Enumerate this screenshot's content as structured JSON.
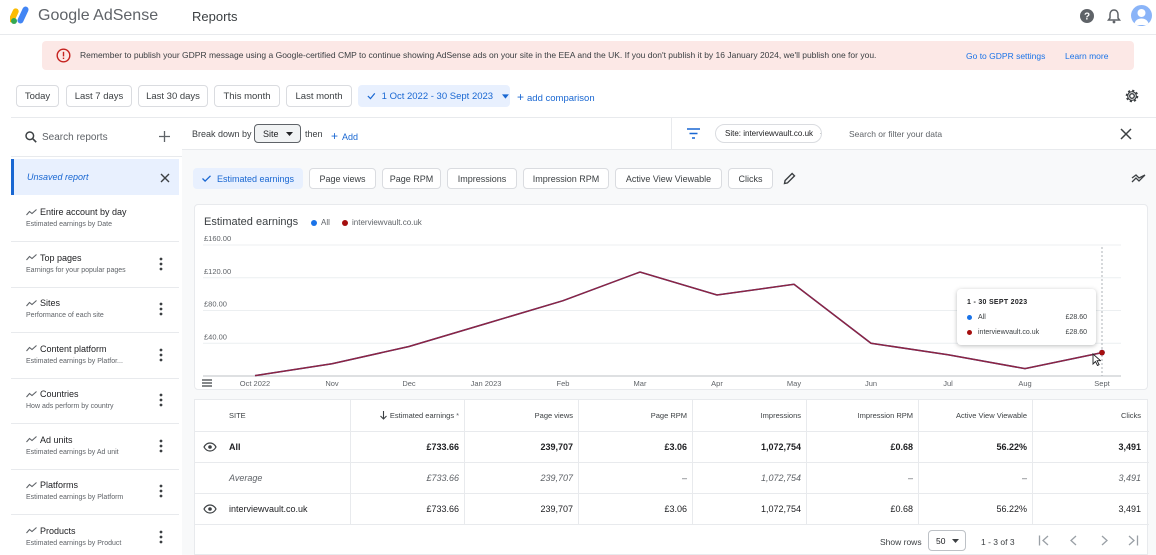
{
  "app": {
    "name": "Google AdSense",
    "page_title": "Reports"
  },
  "colors": {
    "accent": "#1967d2",
    "series_all": "#1a73e8",
    "series_site": "#a50e0e",
    "line": "#8e2440",
    "banner_bg": "#fce8e6"
  },
  "banner": {
    "message": "Remember to publish your GDPR message using a Google-certified CMP to continue showing AdSense ads on your site in the EEA and the UK. If you don't publish it by 16 January 2024, we'll publish one for you.",
    "link_gdpr": "Go to GDPR settings",
    "link_learn": "Learn more"
  },
  "date_chips": [
    "Today",
    "Last 7 days",
    "Last 30 days",
    "This month",
    "Last month"
  ],
  "date_range": "1 Oct 2022 - 30 Sept 2023",
  "add_comparison": "add comparison",
  "sidebar": {
    "search_placeholder": "Search reports",
    "unsaved": "Unsaved report",
    "items": [
      {
        "title": "Entire account by day",
        "subtitle": "Estimated earnings by Date"
      },
      {
        "title": "Top pages",
        "subtitle": "Earnings for your popular pages"
      },
      {
        "title": "Sites",
        "subtitle": "Performance of each site"
      },
      {
        "title": "Content platform",
        "subtitle": "Estimated earnings by Platfor..."
      },
      {
        "title": "Countries",
        "subtitle": "How ads perform by country"
      },
      {
        "title": "Ad units",
        "subtitle": "Estimated earnings by Ad unit"
      },
      {
        "title": "Platforms",
        "subtitle": "Estimated earnings by Platform"
      },
      {
        "title": "Products",
        "subtitle": "Estimated earnings by Product"
      }
    ]
  },
  "toolbar": {
    "break_down_by": "Break down by",
    "dimension": "Site",
    "then": "then",
    "add": "Add",
    "filter_chip": "Site: interviewvault.co.uk",
    "filter_placeholder": "Search or filter your data"
  },
  "metrics": [
    "Estimated earnings",
    "Page views",
    "Page RPM",
    "Impressions",
    "Impression RPM",
    "Active View Viewable",
    "Clicks"
  ],
  "chart": {
    "title": "Estimated earnings",
    "legend": [
      "All",
      "interviewvault.co.uk"
    ],
    "tooltip": {
      "header": "1 - 30 SEPT 2023",
      "rows": [
        {
          "label": "All",
          "value": "£28.60"
        },
        {
          "label": "interviewvault.co.uk",
          "value": "£28.60"
        }
      ]
    }
  },
  "chart_data": {
    "type": "line",
    "title": "Estimated earnings",
    "categories": [
      "Oct 2022",
      "Nov",
      "Dec",
      "Jan 2023",
      "Feb",
      "Mar",
      "Apr",
      "May",
      "Jun",
      "Jul",
      "Aug",
      "Sept"
    ],
    "series": [
      {
        "name": "All",
        "values": [
          0.5,
          15,
          36,
          64,
          92,
          127,
          99,
          112,
          40,
          26,
          9,
          28.6
        ]
      },
      {
        "name": "interviewvault.co.uk",
        "values": [
          0.5,
          15,
          36,
          64,
          92,
          127,
          99,
          112,
          40,
          26,
          9,
          28.6
        ]
      }
    ],
    "y_ticks": [
      "£40.00",
      "£80.00",
      "£120.00",
      "£160.00"
    ],
    "ylim": [
      0,
      160
    ],
    "grid": true,
    "xlabel": "",
    "ylabel": ""
  },
  "table": {
    "headers": [
      "SITE",
      "Estimated earnings",
      "Page views",
      "Page RPM",
      "Impressions",
      "Impression RPM",
      "Active View Viewable",
      "Clicks"
    ],
    "total": [
      "All",
      "£733.66",
      "239,707",
      "£3.06",
      "1,072,754",
      "£0.68",
      "56.22%",
      "3,491"
    ],
    "average": [
      "Average",
      "£733.66",
      "239,707",
      "–",
      "1,072,754",
      "–",
      "–",
      "3,491"
    ],
    "rows": [
      [
        "interviewvault.co.uk",
        "£733.66",
        "239,707",
        "£3.06",
        "1,072,754",
        "£0.68",
        "56.22%",
        "3,491"
      ]
    ],
    "show_rows_label": "Show rows",
    "rows_per_page": "50",
    "page_info": "1 - 3 of 3"
  }
}
